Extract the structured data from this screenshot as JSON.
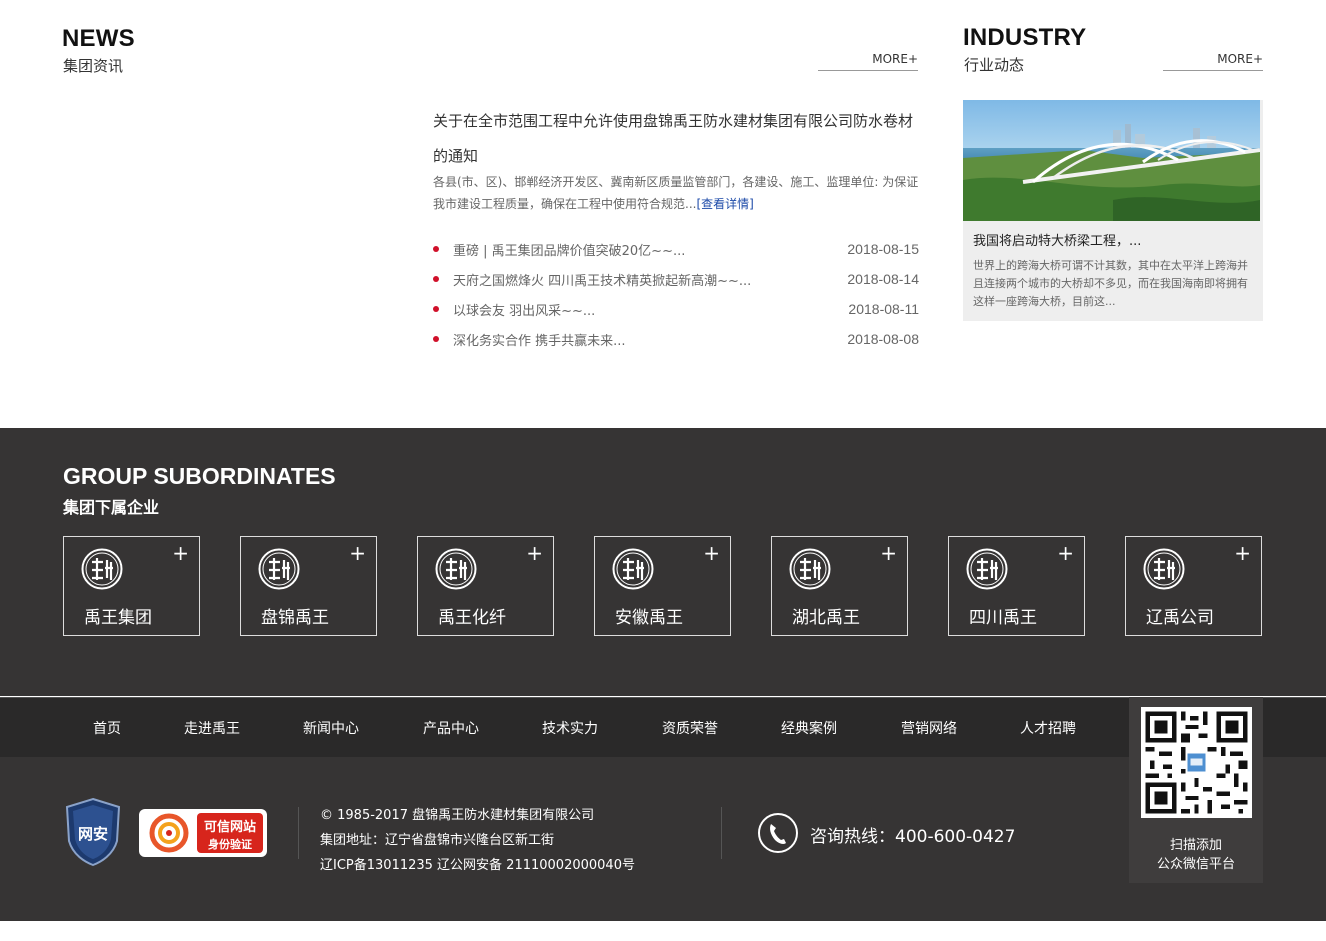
{
  "news": {
    "title_en": "NEWS",
    "title_cn": "集团资讯",
    "more": "MORE+",
    "featured": {
      "title": "关于在全市范围工程中允许使用盘锦禹王防水建材集团有限公司防水卷材的通知",
      "desc": "各县(市、区)、邯郸经济开发区、冀南新区质量监管部门，各建设、施工、监理单位: 为保证我市建设工程质量，确保在工程中使用符合规范...",
      "link": "[查看详情]"
    },
    "items": [
      {
        "text": "重磅 | 禹王集团品牌价值突破20亿~~...",
        "date": "2018-08-15"
      },
      {
        "text": "天府之国燃烽火 四川禹王技术精英掀起新高潮~~...",
        "date": "2018-08-14"
      },
      {
        "text": "以球会友 羽出风采~~...",
        "date": "2018-08-11"
      },
      {
        "text": "深化务实合作 携手共赢未来...",
        "date": "2018-08-08"
      }
    ]
  },
  "industry": {
    "title_en": "INDUSTRY",
    "title_cn": "行业动态",
    "more": "MORE+",
    "card_title": "我国将启动特大桥梁工程，...",
    "card_desc": "世界上的跨海大桥可谓不计其数，其中在太平洋上跨海并且连接两个城市的大桥却不多见，而在我国海南即将拥有这样一座跨海大桥，目前这..."
  },
  "group": {
    "title_en": "GROUP SUBORDINATES",
    "title_cn": "集团下属企业",
    "companies": [
      "禹王集团",
      "盘锦禹王",
      "禹王化纤",
      "安徽禹王",
      "湖北禹王",
      "四川禹王",
      "辽禹公司"
    ]
  },
  "nav": [
    "首页",
    "走进禹王",
    "新闻中心",
    "产品中心",
    "技术实力",
    "资质荣誉",
    "经典案例",
    "营销网络",
    "人才招聘"
  ],
  "footer": {
    "badge1_text": "网安",
    "badge2_line1": "可信网站",
    "badge2_line2": "身份验证",
    "copyright": "© 1985-2017 盘锦禹王防水建材集团有限公司",
    "address": "集团地址：辽宁省盘锦市兴隆台区新工街",
    "icp": "辽ICP备13011235 辽公网安备 21110002000040号",
    "hotline": "咨询热线：400-600-0427",
    "qr_line1": "扫描添加",
    "qr_line2": "公众微信平台"
  }
}
